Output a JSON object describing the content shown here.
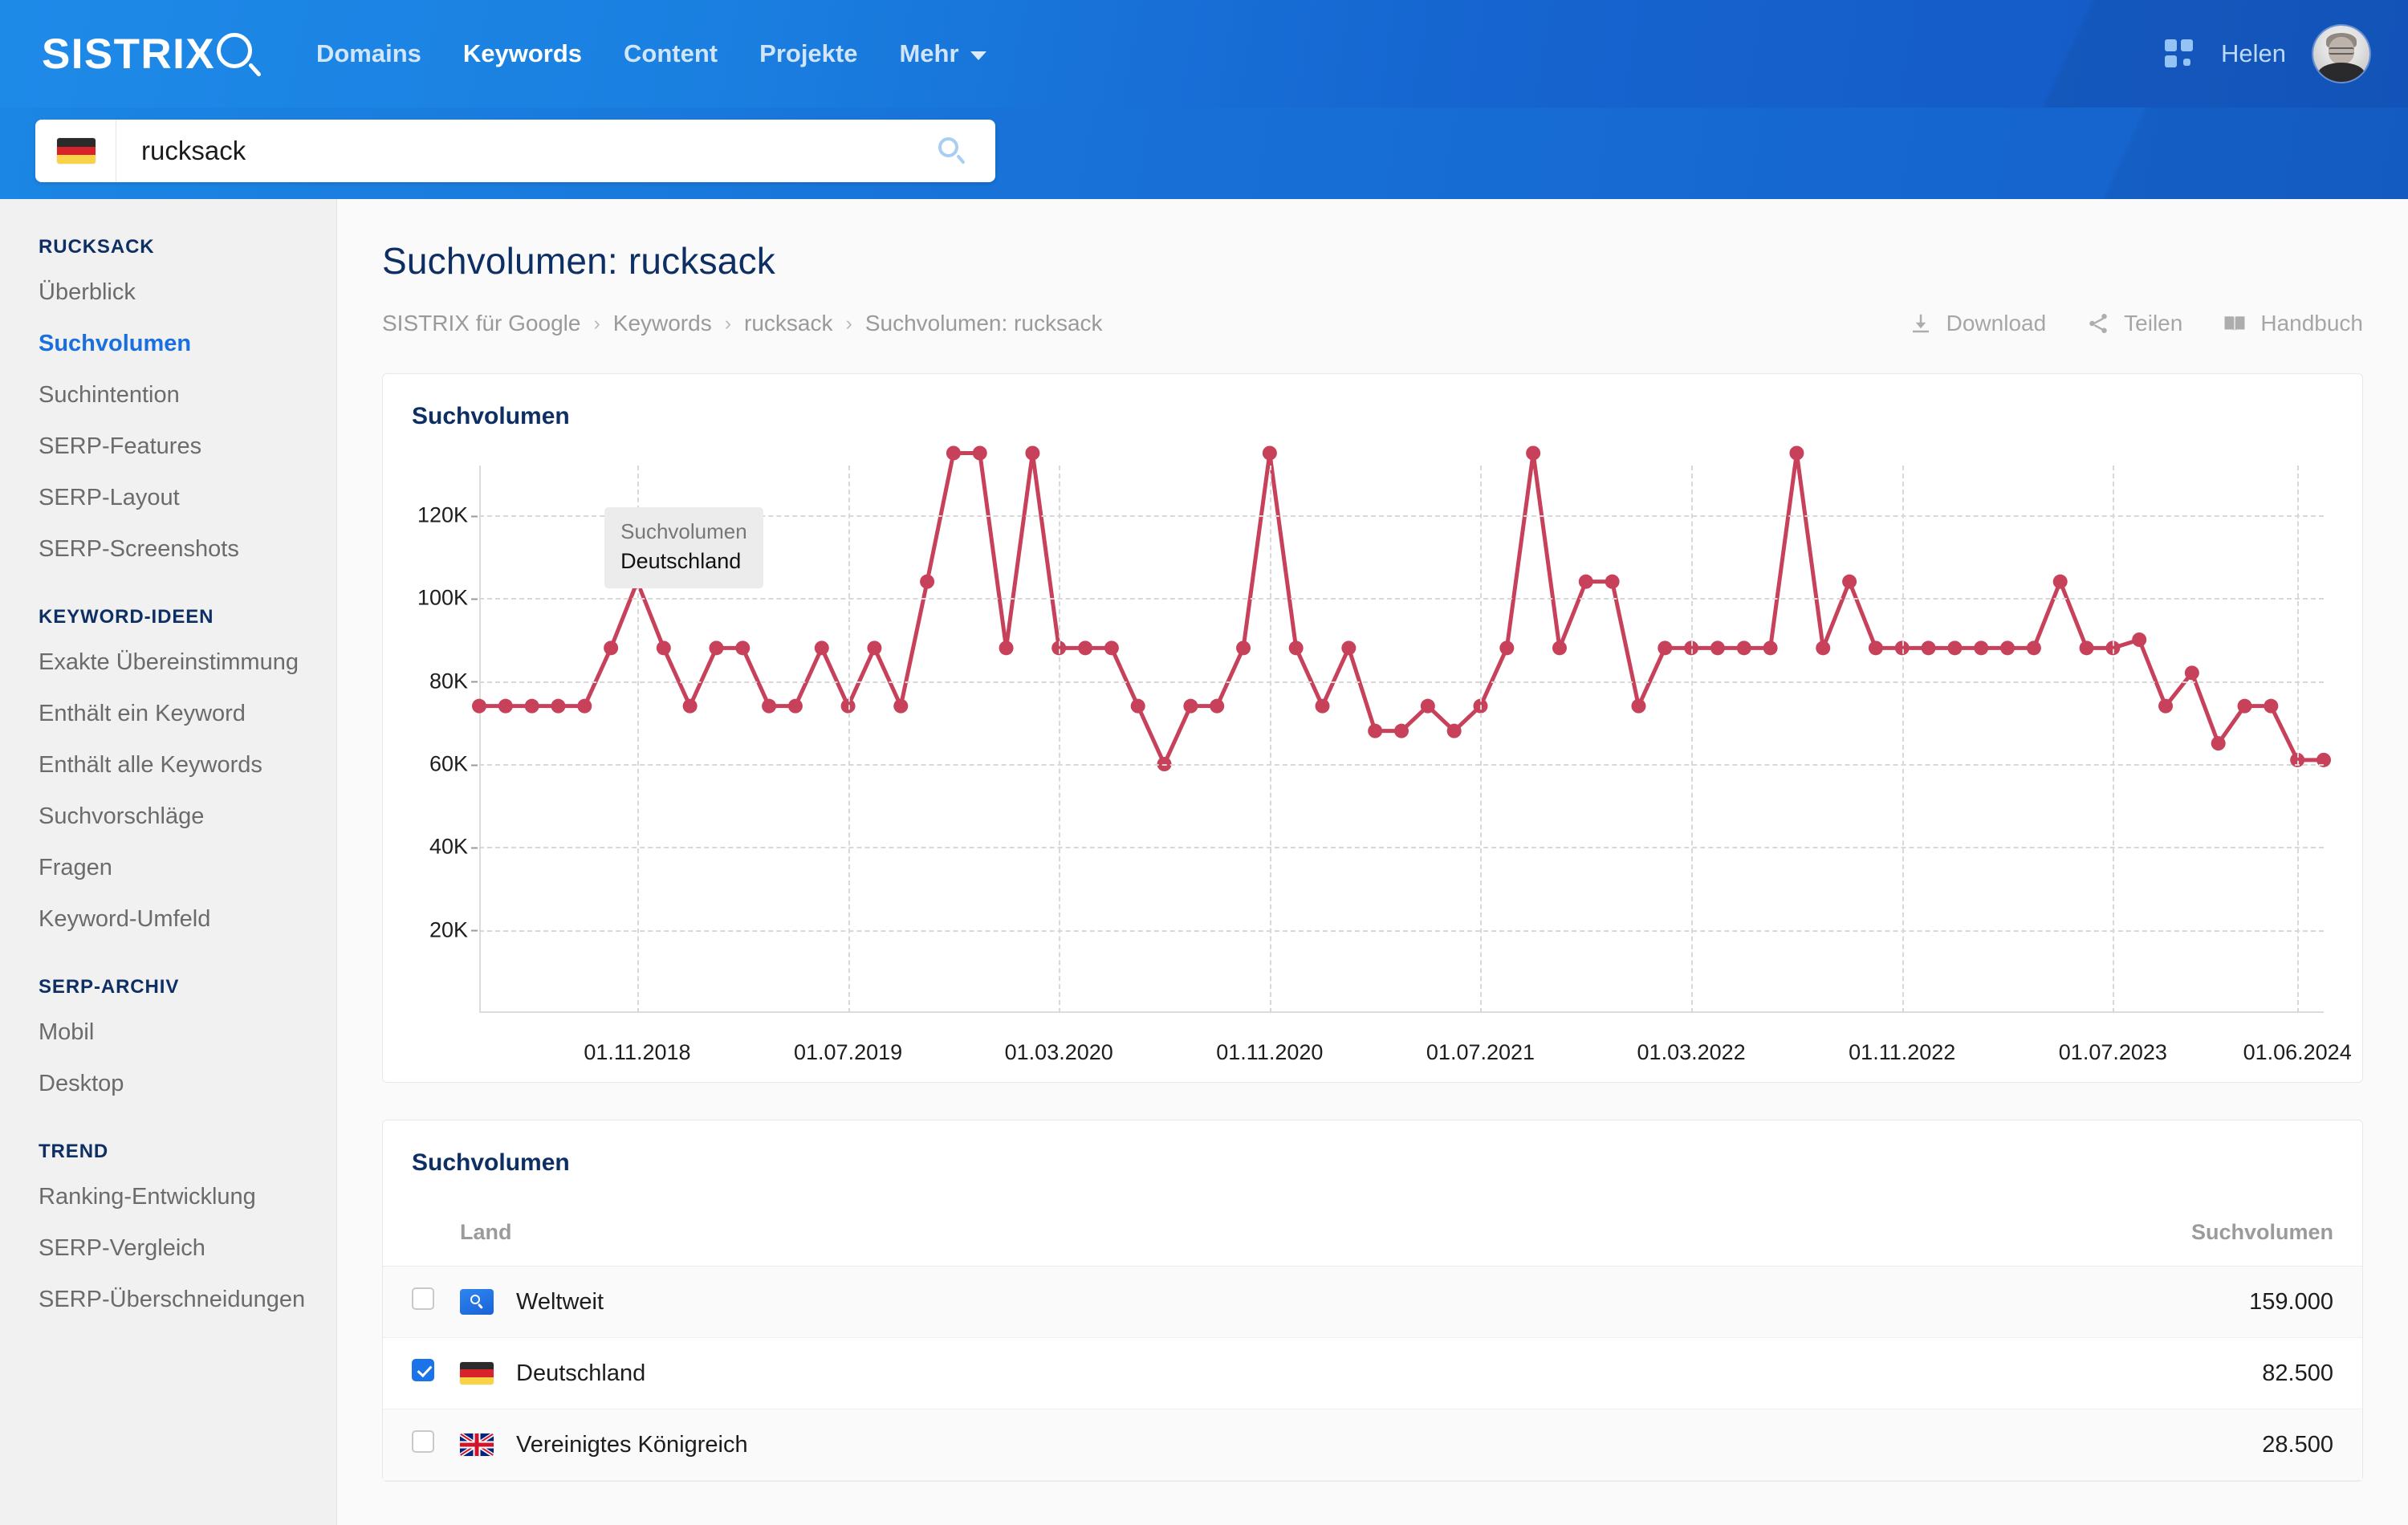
{
  "header": {
    "logo_text": "SISTRIX",
    "nav": [
      {
        "label": "Domains",
        "active": false
      },
      {
        "label": "Keywords",
        "active": true
      },
      {
        "label": "Content",
        "active": false
      },
      {
        "label": "Projekte",
        "active": false
      },
      {
        "label": "Mehr",
        "active": false
      }
    ],
    "username": "Helen"
  },
  "search": {
    "value": "rucksack",
    "placeholder": "rucksack",
    "country_flag": "germany-flag"
  },
  "sidebar": {
    "groups": [
      {
        "title": "RUCKSACK",
        "items": [
          {
            "label": "Überblick",
            "active": false
          },
          {
            "label": "Suchvolumen",
            "active": true
          },
          {
            "label": "Suchintention",
            "active": false
          },
          {
            "label": "SERP-Features",
            "active": false
          },
          {
            "label": "SERP-Layout",
            "active": false
          },
          {
            "label": "SERP-Screenshots",
            "active": false
          }
        ]
      },
      {
        "title": "KEYWORD-IDEEN",
        "items": [
          {
            "label": "Exakte Übereinstimmung",
            "active": false
          },
          {
            "label": "Enthält ein Keyword",
            "active": false
          },
          {
            "label": "Enthält alle Keywords",
            "active": false
          },
          {
            "label": "Suchvorschläge",
            "active": false
          },
          {
            "label": "Fragen",
            "active": false
          },
          {
            "label": "Keyword-Umfeld",
            "active": false
          }
        ]
      },
      {
        "title": "SERP-ARCHIV",
        "items": [
          {
            "label": "Mobil",
            "active": false
          },
          {
            "label": "Desktop",
            "active": false
          }
        ]
      },
      {
        "title": "TREND",
        "items": [
          {
            "label": "Ranking-Entwicklung",
            "active": false
          },
          {
            "label": "SERP-Vergleich",
            "active": false
          },
          {
            "label": "SERP-Überschneidungen",
            "active": false
          }
        ]
      }
    ]
  },
  "main": {
    "title": "Suchvolumen: rucksack",
    "breadcrumb": [
      "SISTRIX für Google",
      "Keywords",
      "rucksack",
      "Suchvolumen: rucksack"
    ],
    "breadcrumb_separator": "›",
    "actions": [
      {
        "label": "Download",
        "icon": "download-icon"
      },
      {
        "label": "Teilen",
        "icon": "share-icon"
      },
      {
        "label": "Handbuch",
        "icon": "book-icon"
      }
    ],
    "chart_card_title": "Suchvolumen",
    "table_card_title": "Suchvolumen",
    "tooltip": {
      "series": "Suchvolumen",
      "country": "Deutschland"
    }
  },
  "table": {
    "columns": [
      "Land",
      "Suchvolumen"
    ],
    "rows": [
      {
        "checked": false,
        "flag": "worldwide-icon",
        "land": "Weltweit",
        "suchvolumen": "159.000"
      },
      {
        "checked": true,
        "flag": "germany-flag",
        "land": "Deutschland",
        "suchvolumen": "82.500"
      },
      {
        "checked": false,
        "flag": "uk-flag",
        "land": "Vereinigtes Königreich",
        "suchvolumen": "28.500"
      }
    ]
  },
  "colors": {
    "brand_blue": "#1a6fe0",
    "navy": "#0e2f63",
    "series_red": "#c8415a",
    "accent_checkbox": "#1a73e8"
  },
  "chart_data": {
    "type": "line",
    "title": "Suchvolumen",
    "xlabel": "",
    "ylabel": "",
    "ylim": [
      0,
      132000
    ],
    "yticks": [
      20000,
      40000,
      60000,
      80000,
      100000,
      120000
    ],
    "ytick_labels": [
      "20K",
      "40K",
      "60K",
      "80K",
      "100K",
      "120K"
    ],
    "grid": true,
    "legend": "none",
    "series_color": "#c8415a",
    "marker": "circle",
    "xtick_labels": [
      "01.11.2018",
      "01.07.2019",
      "01.03.2020",
      "01.11.2020",
      "01.07.2021",
      "01.03.2022",
      "01.11.2022",
      "01.07.2023",
      "01.06.2024"
    ],
    "xtick_indices": [
      6,
      14,
      22,
      30,
      38,
      46,
      54,
      62,
      69
    ],
    "series": [
      {
        "name": "Suchvolumen Deutschland",
        "values": [
          74000,
          74000,
          74000,
          74000,
          74000,
          88000,
          104000,
          88000,
          74000,
          88000,
          88000,
          74000,
          74000,
          88000,
          74000,
          88000,
          74000,
          104000,
          135000,
          135000,
          88000,
          135000,
          88000,
          88000,
          88000,
          74000,
          60000,
          74000,
          74000,
          88000,
          135000,
          88000,
          74000,
          88000,
          68000,
          68000,
          74000,
          68000,
          74000,
          88000,
          135000,
          88000,
          104000,
          104000,
          74000,
          88000,
          88000,
          88000,
          88000,
          88000,
          135000,
          88000,
          104000,
          88000,
          88000,
          88000,
          88000,
          88000,
          88000,
          88000,
          104000,
          88000,
          88000,
          90000,
          74000,
          82000,
          65000,
          74000,
          74000,
          61000,
          61000
        ]
      }
    ]
  }
}
